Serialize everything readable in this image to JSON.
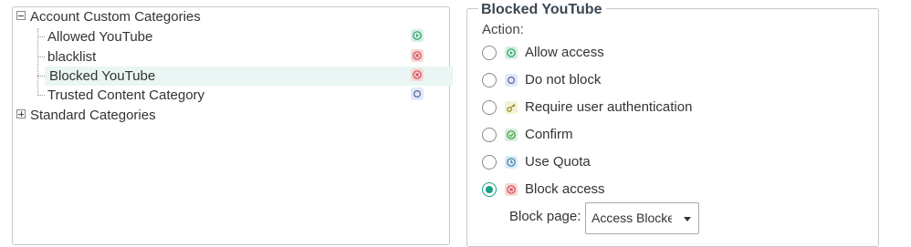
{
  "tree": {
    "account_custom": {
      "label": "Account Custom Categories",
      "expanded": true,
      "items": [
        {
          "label": "Allowed YouTube",
          "icon": "allow-circle-icon",
          "color": "#2e9e6b"
        },
        {
          "label": "blacklist",
          "icon": "block-x-icon",
          "color": "#d24d57"
        },
        {
          "label": "Blocked YouTube",
          "icon": "block-x-icon",
          "color": "#d24d57",
          "selected": true
        },
        {
          "label": "Trusted Content Category",
          "icon": "circle-outline-icon",
          "color": "#5563a8"
        }
      ]
    },
    "standard": {
      "label": "Standard Categories",
      "expanded": false
    }
  },
  "detail": {
    "title": "Blocked YouTube",
    "action_label": "Action:",
    "options": [
      {
        "label": "Allow access",
        "icon": "allow-circle-icon",
        "checked": false
      },
      {
        "label": "Do not block",
        "icon": "circle-outline-icon",
        "checked": false
      },
      {
        "label": "Require user authentication",
        "icon": "key-icon",
        "checked": false
      },
      {
        "label": "Confirm",
        "icon": "check-circle-icon",
        "checked": false
      },
      {
        "label": "Use Quota",
        "icon": "clock-icon",
        "checked": false
      },
      {
        "label": "Block access",
        "icon": "block-x-icon",
        "checked": true
      }
    ],
    "block_page_label": "Block page:",
    "block_page_value": "Access Blocked"
  },
  "colors": {
    "accent": "#16a085",
    "selected_row": "#e9f6f3",
    "border": "#c8c8c8"
  }
}
